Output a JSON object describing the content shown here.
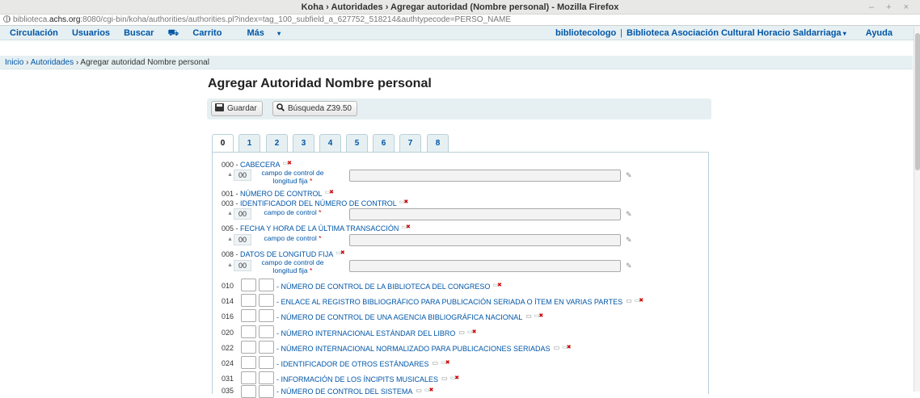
{
  "window": {
    "title": "Koha › Autoridades › Agregar autoridad (Nombre personal) - Mozilla Firefox",
    "controls": "– + ×"
  },
  "url": {
    "prefix": "biblioteca.",
    "host": "achs.org",
    "rest": ":8080/cgi-bin/koha/authorities/authorities.pl?index=tag_100_subfield_a_627752_518214&authtypecode=PERSO_NAME"
  },
  "nav": {
    "items": [
      "Circulación",
      "Usuarios",
      "Buscar",
      "Carrito",
      "Más"
    ],
    "user": "bibliotecologo",
    "library": "Biblioteca Asociación Cultural Horacio Saldarriaga",
    "help": "Ayuda"
  },
  "breadcrumb": {
    "home": "Inicio",
    "section": "Autoridades",
    "current": "Agregar autoridad Nombre personal"
  },
  "page_title": "Agregar Autoridad Nombre personal",
  "toolbar": {
    "save_label": "Guardar",
    "z3950_label": "Búsqueda Z39.50"
  },
  "tabs": [
    "0",
    "1",
    "2",
    "3",
    "4",
    "5",
    "6",
    "7",
    "8"
  ],
  "active_tab": "0",
  "fields": [
    {
      "tag": "000",
      "name": "CABECERA",
      "sub_code": "00",
      "sub_label_1": "campo de control de",
      "sub_label_2": "longitud fija"
    },
    {
      "tag": "001",
      "name": "NÚMERO DE CONTROL"
    },
    {
      "tag": "003",
      "name": "IDENTIFICADOR DEL NÚMERO DE CONTROL",
      "sub_code": "00",
      "sub_label_1": "campo de control"
    },
    {
      "tag": "005",
      "name": "FECHA Y HORA DE LA ÚLTIMA TRANSACCIÓN",
      "sub_code": "00",
      "sub_label_1": "campo de control"
    },
    {
      "tag": "008",
      "name": "DATOS DE LONGITUD FIJA",
      "sub_code": "00",
      "sub_label_1": "campo de control de",
      "sub_label_2": "longitud fija"
    }
  ],
  "datafields": [
    {
      "tag": "010",
      "name": "NÚMERO DE CONTROL DE LA BIBLIOTECA DEL CONGRESO"
    },
    {
      "tag": "014",
      "name": "ENLACE AL REGISTRO BIBLIOGRÁFICO PARA PUBLICACIÓN SERIADA O ÍTEM EN VARIAS PARTES"
    },
    {
      "tag": "016",
      "name": "NÚMERO DE CONTROL DE UNA AGENCIA BIBLIOGRÁFICA NACIONAL"
    },
    {
      "tag": "020",
      "name": "NÚMERO INTERNACIONAL ESTÁNDAR DEL LIBRO"
    },
    {
      "tag": "022",
      "name": "NÚMERO INTERNACIONAL NORMALIZADO PARA PUBLICACIONES SERIADAS"
    },
    {
      "tag": "024",
      "name": "IDENTIFICADOR DE OTROS ESTÁNDARES"
    },
    {
      "tag": "031",
      "name": "INFORMACIÓN DE LOS ÍNCIPITS MUSICALES"
    },
    {
      "tag": "035",
      "name": "NÚMERO DE CONTROL DEL SISTEMA"
    }
  ],
  "required_mark": "*",
  "colors": {
    "link": "#0056a7",
    "nav_bg": "#e6f0f2",
    "required": "#cc0000"
  }
}
